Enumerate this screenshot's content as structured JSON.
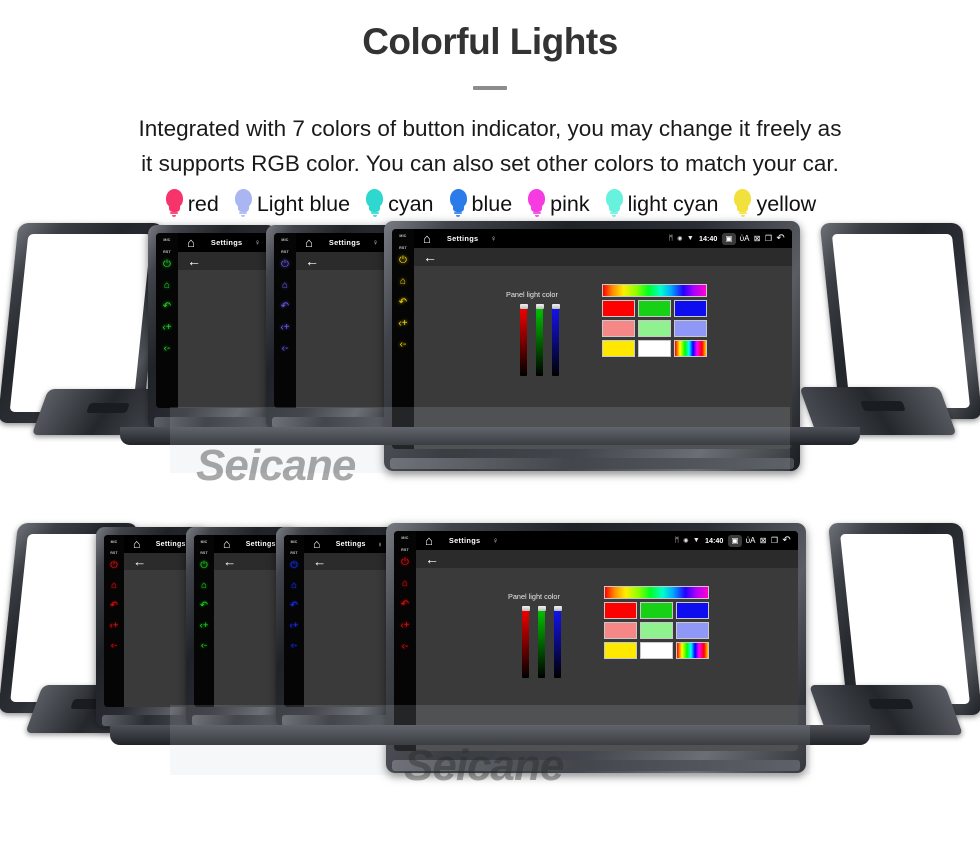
{
  "header": {
    "title": "Colorful Lights",
    "subtitle_line1": "Integrated with 7 colors of button indicator, you may change it freely as",
    "subtitle_line2": "it supports RGB color. You can also set other colors to match your car."
  },
  "legend": {
    "items": [
      {
        "label": "red",
        "color": "#f7336b",
        "icon": "bulb-icon"
      },
      {
        "label": "Light blue",
        "color": "#a9b6f2",
        "icon": "bulb-icon"
      },
      {
        "label": "cyan",
        "color": "#2ed8cf",
        "icon": "bulb-icon"
      },
      {
        "label": "blue",
        "color": "#2b7ce8",
        "icon": "bulb-icon"
      },
      {
        "label": "pink",
        "color": "#f63ce0",
        "icon": "bulb-icon"
      },
      {
        "label": "light cyan",
        "color": "#67f2dd",
        "icon": "bulb-icon"
      },
      {
        "label": "yellow",
        "color": "#f2e03c",
        "icon": "bulb-icon"
      }
    ]
  },
  "statusbar": {
    "home_icon": "home-icon",
    "title": "Settings",
    "mic_icon": "mic-icon",
    "bluetooth_icon": "bluetooth-icon",
    "gps_icon": "gps-icon",
    "wifi_icon": "wifi-icon",
    "time": "14:40",
    "camera_icon": "camera-icon",
    "volume_icon": "volume-icon",
    "close_icon": "close-icon",
    "recents_icon": "recent-apps-icon",
    "back_icon": "back-icon"
  },
  "button_strip": {
    "mic_label": "MIC",
    "rst_label": "RST",
    "buttons": [
      {
        "name": "power-button",
        "glyph": "⏻"
      },
      {
        "name": "home-button",
        "glyph": "⌂"
      },
      {
        "name": "back-button",
        "glyph": "↶"
      },
      {
        "name": "volume-up-button",
        "glyph": "‹+"
      },
      {
        "name": "volume-down-button",
        "glyph": "‹-"
      }
    ]
  },
  "settings_screen": {
    "back_arrow": "←",
    "panel_label": "Panel light color",
    "sliders": [
      {
        "name": "red-slider",
        "color": "#ff0000",
        "value": 100
      },
      {
        "name": "green-slider",
        "color": "#00cc00",
        "value": 100
      },
      {
        "name": "blue-slider",
        "color": "#1414ff",
        "value": 100
      }
    ],
    "swatches": [
      {
        "name": "swatch-rainbow",
        "color": "rainbow-wide"
      },
      {
        "name": "swatch-red",
        "color": "#ff0000"
      },
      {
        "name": "swatch-green",
        "color": "#17d117"
      },
      {
        "name": "swatch-blue",
        "color": "#0d0df0"
      },
      {
        "name": "swatch-salmon",
        "color": "#f58787"
      },
      {
        "name": "swatch-light-green",
        "color": "#8ff28f"
      },
      {
        "name": "swatch-periwinkle",
        "color": "#8f97f7"
      },
      {
        "name": "swatch-yellow",
        "color": "#ffe800"
      },
      {
        "name": "swatch-white",
        "color": "#ffffff"
      },
      {
        "name": "swatch-spectrum",
        "color": "rainbow-narrow"
      }
    ]
  },
  "units": {
    "row1": [
      {
        "name": "unit-green",
        "led_color": "#24d62a"
      },
      {
        "name": "unit-purple",
        "led_color": "#6a5cf0"
      },
      {
        "name": "unit-yellow",
        "led_color": "#f2d400"
      }
    ],
    "row2": [
      {
        "name": "unit-red",
        "led_color": "#e01010"
      },
      {
        "name": "unit-green",
        "led_color": "#18d618"
      },
      {
        "name": "unit-blue",
        "led_color": "#1830f5"
      },
      {
        "name": "unit-red-main",
        "led_color": "#e01010"
      }
    ]
  },
  "watermark": {
    "text": "Seicane"
  }
}
